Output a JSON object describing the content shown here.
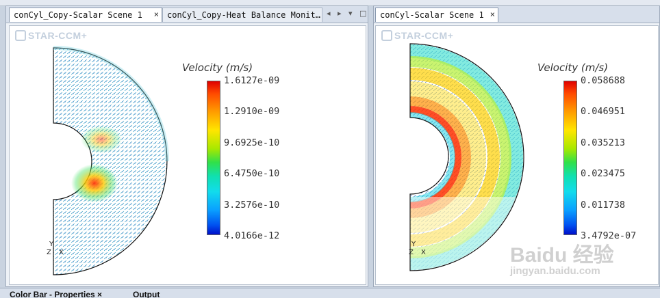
{
  "left_pane": {
    "tabs": [
      {
        "label": "conCyl_Copy-Scalar Scene 1",
        "close": "×",
        "active": true
      },
      {
        "label": "conCyl_Copy-Heat Balance Monit…",
        "active": false
      }
    ],
    "nav": {
      "left": "◂",
      "right": "▸",
      "menu": "▾",
      "maximize": "□"
    },
    "logo": "STAR-CCM+",
    "colorbar": {
      "title": "Velocity (m/s)",
      "ticks": [
        "1.6127e-09",
        "1.2910e-09",
        "9.6925e-10",
        "6.4750e-10",
        "3.2576e-10",
        "4.0166e-12"
      ]
    },
    "triad": {
      "y": "Y",
      "z": "Z",
      "x": "X"
    }
  },
  "right_pane": {
    "tabs": [
      {
        "label": "conCyl-Scalar Scene 1",
        "close": "×",
        "active": true
      }
    ],
    "logo": "STAR-CCM+",
    "colorbar": {
      "title": "Velocity (m/s)",
      "ticks": [
        "0.058688",
        "0.046951",
        "0.035213",
        "0.023475",
        "0.011738",
        "3.4792e-07"
      ]
    },
    "triad": {
      "y": "Y",
      "z": "Z",
      "x": "X"
    }
  },
  "bottom_tabs": [
    {
      "label": "Color Bar - Properties",
      "close": "×"
    },
    {
      "label": "Output"
    }
  ],
  "watermark": {
    "brand": "Baidu 经验",
    "url": "jingyan.baidu.com"
  },
  "colors": {
    "accent": "#d7dfeb",
    "colorbar_max": "#e00000",
    "colorbar_min": "#0010c8"
  }
}
